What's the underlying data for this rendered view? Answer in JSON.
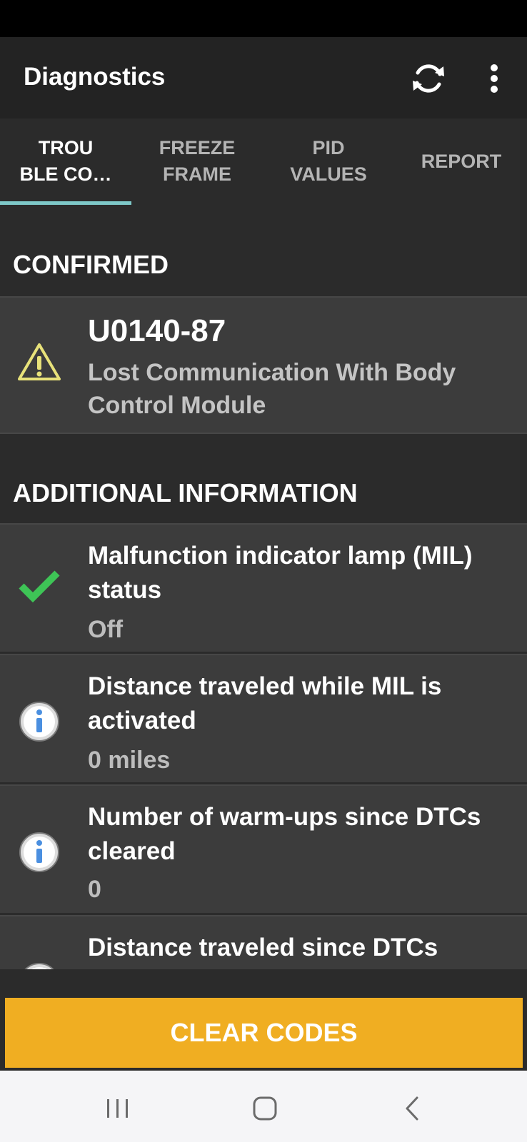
{
  "app": {
    "title": "Diagnostics"
  },
  "toolbar": {
    "refresh_icon": "refresh-icon",
    "more_icon": "more-vert-icon"
  },
  "tabs": [
    {
      "label": "TROU\nBLE CO…",
      "active": true
    },
    {
      "label": "FREEZE\nFRAME",
      "active": false
    },
    {
      "label": "PID\nVALUES",
      "active": false
    },
    {
      "label": "REPORT",
      "active": false
    }
  ],
  "confirmed": {
    "header": "CONFIRMED",
    "code": "U0140-87",
    "description": "Lost Communication With Body Control Module",
    "icon": "warning-icon",
    "icon_color": "#e8e27a"
  },
  "additional": {
    "header": "ADDITIONAL INFORMATION",
    "items": [
      {
        "title": "Malfunction indicator lamp (MIL) status",
        "value": "Off",
        "icon": "check-icon"
      },
      {
        "title": "Distance traveled while MIL is activated",
        "value": "0 miles",
        "icon": "info-icon"
      },
      {
        "title": "Number of warm-ups since DTCs cleared",
        "value": "0",
        "icon": "info-icon"
      },
      {
        "title": "Distance traveled since DTCs",
        "value": "",
        "icon": "info-icon"
      }
    ]
  },
  "actions": {
    "clear_label": "CLEAR CODES",
    "accent": "#f0ae22"
  },
  "nav": {
    "recents_icon": "recents-icon",
    "home_icon": "home-icon",
    "back_icon": "back-icon"
  }
}
